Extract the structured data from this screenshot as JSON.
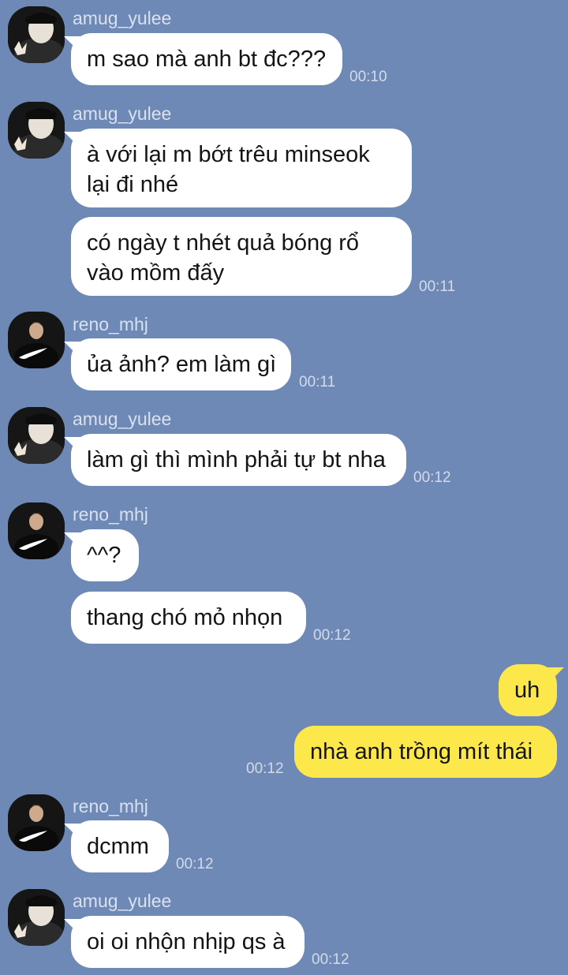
{
  "users": {
    "amug": "amug_yulee",
    "reno": "reno_mhj"
  },
  "messages": [
    {
      "text": "m sao mà anh bt đc???",
      "time": "00:10"
    },
    {
      "line1": "à với lại m bớt trêu minseok",
      "line2": "lại đi nhé"
    },
    {
      "line1": "có ngày t nhét quả bóng rổ",
      "line2": "vào mồm đấy",
      "time": "00:11"
    },
    {
      "text": "ủa ảnh? em làm gì",
      "time": "00:11"
    },
    {
      "text": "làm gì thì mình phải tự bt nha",
      "time": "00:12"
    },
    {
      "text": "^^?"
    },
    {
      "text": "thang chó mỏ nhọn",
      "time": "00:12"
    },
    {
      "text": "uh"
    },
    {
      "text": "nhà anh trồng mít thái",
      "time": "00:12"
    },
    {
      "text": "dcmm",
      "time": "00:12"
    },
    {
      "text": "oi oi nhộn nhịp qs à",
      "time": "00:12"
    }
  ],
  "colors": {
    "background": "#6f89b6",
    "incoming_bubble": "#ffffff",
    "outgoing_bubble": "#fde84c"
  },
  "icons": {
    "avatar_amug": "profile-photo-peace-sign",
    "avatar_reno": "profile-photo-dark-hoodie"
  }
}
